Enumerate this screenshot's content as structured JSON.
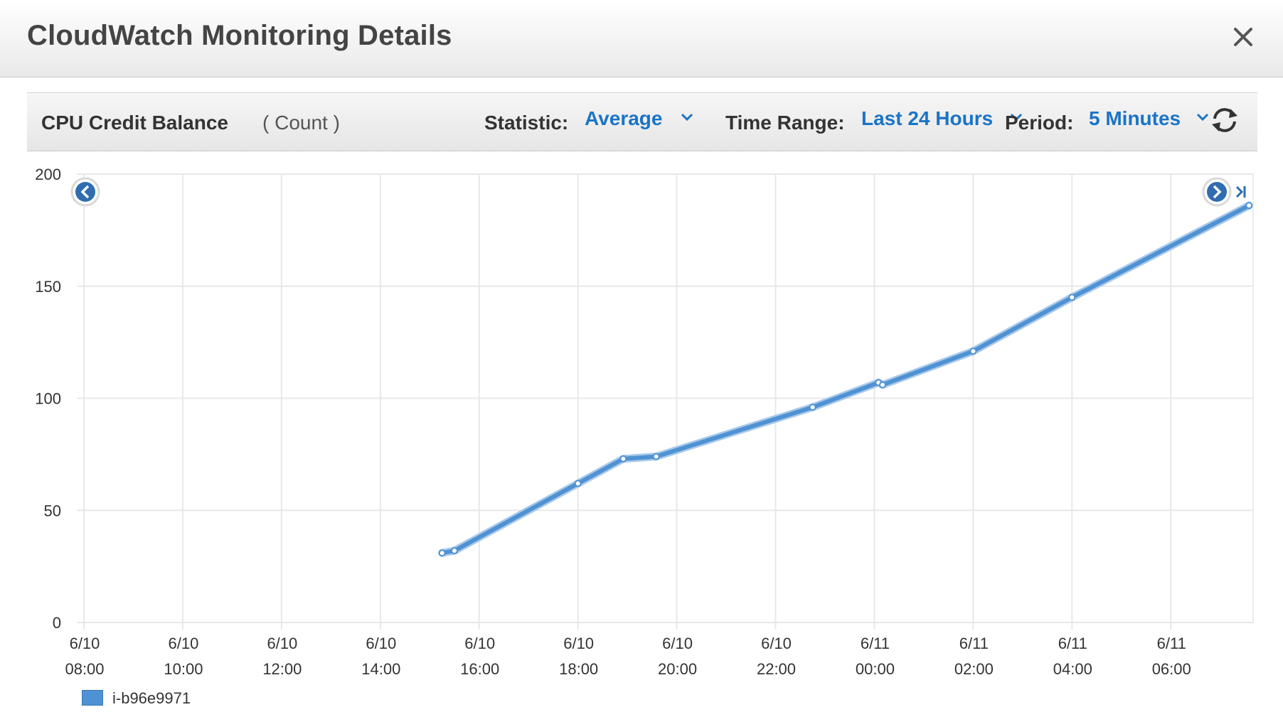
{
  "window": {
    "title": "CloudWatch Monitoring Details",
    "close_icon": "close-icon"
  },
  "toolbar": {
    "metric_name": "CPU Credit Balance",
    "metric_unit": "( Count )",
    "statistic_label": "Statistic:",
    "statistic_value": "Average",
    "time_range_label": "Time Range:",
    "time_range_value": "Last 24 Hours",
    "period_label": "Period:",
    "period_value": "5 Minutes",
    "refresh_icon": "refresh-icon",
    "link_color": "#1a74c6"
  },
  "chart_data": {
    "type": "line",
    "title": "",
    "xlabel": "",
    "ylabel": "",
    "ylim": [
      0,
      200
    ],
    "yticks": [
      0,
      50,
      100,
      150,
      200
    ],
    "xlim": [
      "2016-06-10T08:00",
      "2016-06-11T07:40"
    ],
    "xticks": [
      {
        "date": "6/10",
        "time": "08:00"
      },
      {
        "date": "6/10",
        "time": "10:00"
      },
      {
        "date": "6/10",
        "time": "12:00"
      },
      {
        "date": "6/10",
        "time": "14:00"
      },
      {
        "date": "6/10",
        "time": "16:00"
      },
      {
        "date": "6/10",
        "time": "18:00"
      },
      {
        "date": "6/10",
        "time": "20:00"
      },
      {
        "date": "6/10",
        "time": "22:00"
      },
      {
        "date": "6/11",
        "time": "00:00"
      },
      {
        "date": "6/11",
        "time": "02:00"
      },
      {
        "date": "6/11",
        "time": "04:00"
      },
      {
        "date": "6/11",
        "time": "06:00"
      }
    ],
    "grid": true,
    "legend_position": "bottom-left",
    "series": [
      {
        "name": "i-b96e9971",
        "color": "#4f92d4",
        "points": [
          {
            "t": "2016-06-10T15:15",
            "y": 31
          },
          {
            "t": "2016-06-10T15:30",
            "y": 32
          },
          {
            "t": "2016-06-10T18:00",
            "y": 62
          },
          {
            "t": "2016-06-10T18:55",
            "y": 73
          },
          {
            "t": "2016-06-10T19:35",
            "y": 74
          },
          {
            "t": "2016-06-10T22:45",
            "y": 96
          },
          {
            "t": "2016-06-11T00:05",
            "y": 107
          },
          {
            "t": "2016-06-11T00:10",
            "y": 106
          },
          {
            "t": "2016-06-11T02:00",
            "y": 121
          },
          {
            "t": "2016-06-11T04:00",
            "y": 145
          },
          {
            "t": "2016-06-11T07:35",
            "y": 186
          }
        ]
      }
    ]
  }
}
